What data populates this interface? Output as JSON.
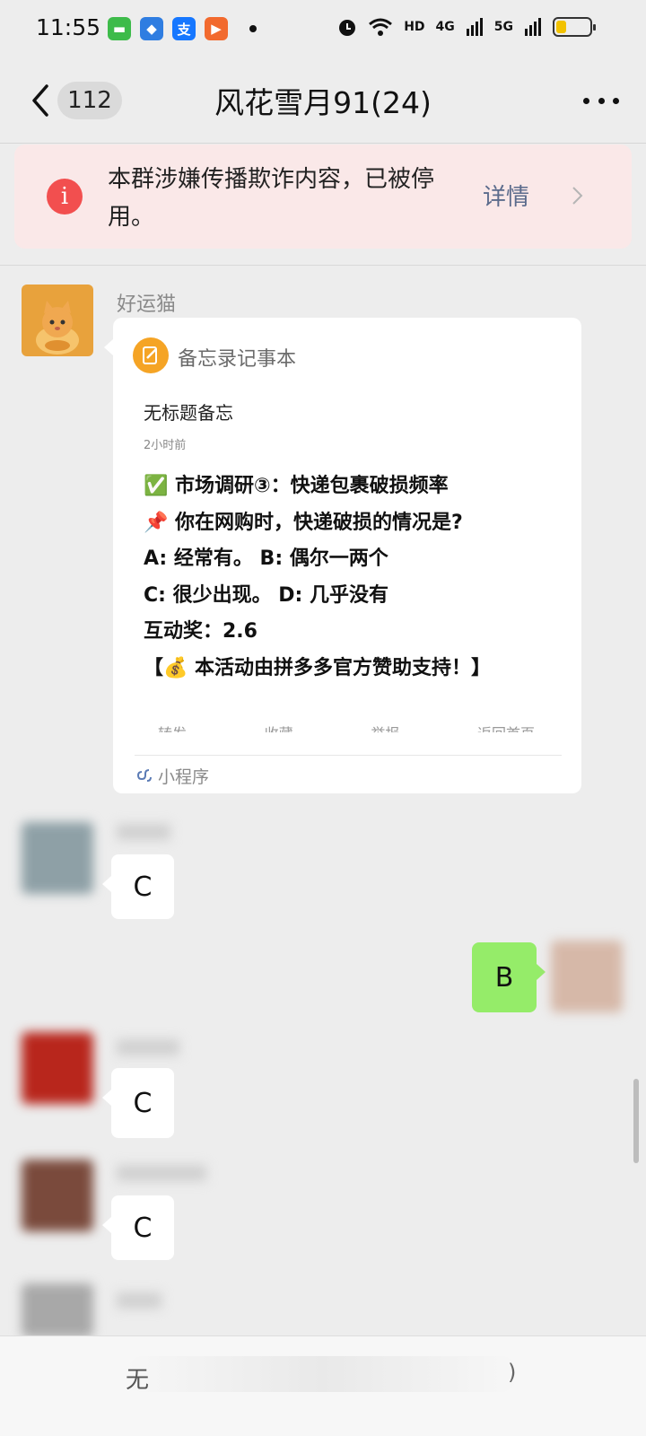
{
  "status_bar": {
    "time": "11:55",
    "app_icons": [
      "messages-icon",
      "baidu-icon",
      "alipay-icon",
      "video-app-icon"
    ],
    "network_labels": [
      "HD",
      "4G",
      "5G"
    ],
    "battery_level": 0.3
  },
  "header": {
    "unread_count": "112",
    "title": "风花雪月91(24)"
  },
  "warning": {
    "text": "本群涉嫌传播欺诈内容，已被停用。",
    "link_label": "详情"
  },
  "messages": [
    {
      "sender": "好运猫",
      "type": "mini_program",
      "card": {
        "app_name": "备忘录记事本",
        "note_title": "无标题备忘",
        "note_time": "2小时前",
        "lines": [
          "✅ 市场调研③：快递包裹破损频率",
          "📌 你在网购时，快递破损的情况是?",
          "A: 经常有。  B: 偶尔一两个",
          "C: 很少出现。 D: 几乎没有",
          "互动奖：2.6",
          "【💰 本活动由拼多多官方赞助支持！】"
        ],
        "actions": [
          "转发",
          "收藏",
          "举报",
          "返回首页"
        ],
        "footer_label": "小程序"
      }
    },
    {
      "sender": "",
      "type": "text",
      "text": "C",
      "direction": "in"
    },
    {
      "sender": "",
      "type": "text",
      "text": "B",
      "direction": "out"
    },
    {
      "sender": "",
      "type": "text",
      "text": "C",
      "direction": "in"
    },
    {
      "sender": "",
      "type": "text",
      "text": "C",
      "direction": "in"
    }
  ],
  "input": {
    "visible_text": "无",
    "end_text": ")"
  },
  "colors": {
    "background": "#ededed",
    "warning_bg": "#fae8e8",
    "warning_icon": "#f24f4f",
    "outgoing_bubble": "#95ec69",
    "link": "#5b6b8c"
  }
}
